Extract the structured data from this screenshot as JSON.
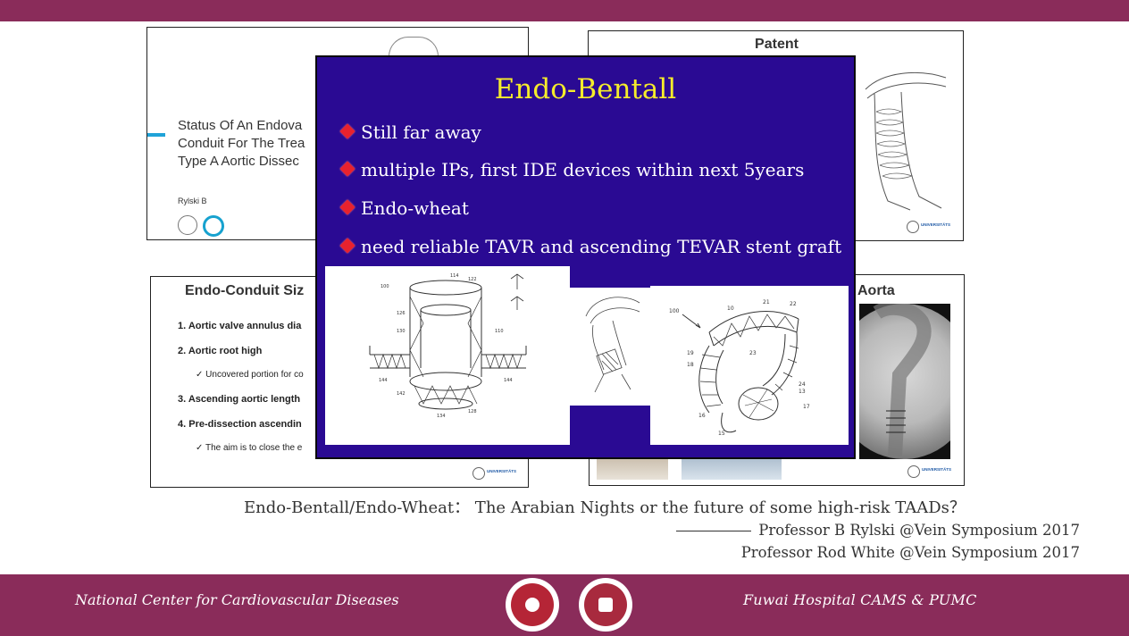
{
  "header": {
    "color": "#8a2c5a"
  },
  "slide1": {
    "title": "Status Of An Endova\nConduit For The Trea\nType A Aortic Dissec",
    "author": "Rylski B"
  },
  "slide2": {
    "title": "Patent"
  },
  "slide3": {
    "title": "Endo-Conduit Siz",
    "items": [
      {
        "label": "1.   Aortic valve annulus dia"
      },
      {
        "label": "2.   Aortic root high"
      },
      {
        "label": "✓  Uncovered portion for co"
      },
      {
        "label": "3.   Ascending aortic length"
      },
      {
        "label": "4.   Pre-dissection ascendin"
      },
      {
        "label": "✓  The aim is to close the e"
      }
    ]
  },
  "slide4": {
    "title": "Aorta"
  },
  "uni_logo_text": {
    "line1": "UNIVERSITÄTS",
    "line2": "HERZZENTRUM"
  },
  "overlay": {
    "title": "Endo-Bentall",
    "title_color": "#f5ec2b",
    "background": "#2a0a93",
    "bullets": [
      "Still far away",
      "multiple IPs, first IDE devices within next 5years",
      "Endo-wheat",
      "need reliable TAVR and ascending TEVAR stent graft"
    ]
  },
  "caption": {
    "main": "Endo-Bentall/Endo-Wheat： The Arabian Nights or the future of some high-risk TAADs？",
    "credit1": "Professor B Rylski @Vein Symposium 2017",
    "credit2": "Professor Rod White @Vein Symposium 2017"
  },
  "footer": {
    "left": "National Center for Cardiovascular Diseases",
    "right": "Fuwai Hospital    CAMS   &    PUMC",
    "color": "#8a2c5a"
  }
}
